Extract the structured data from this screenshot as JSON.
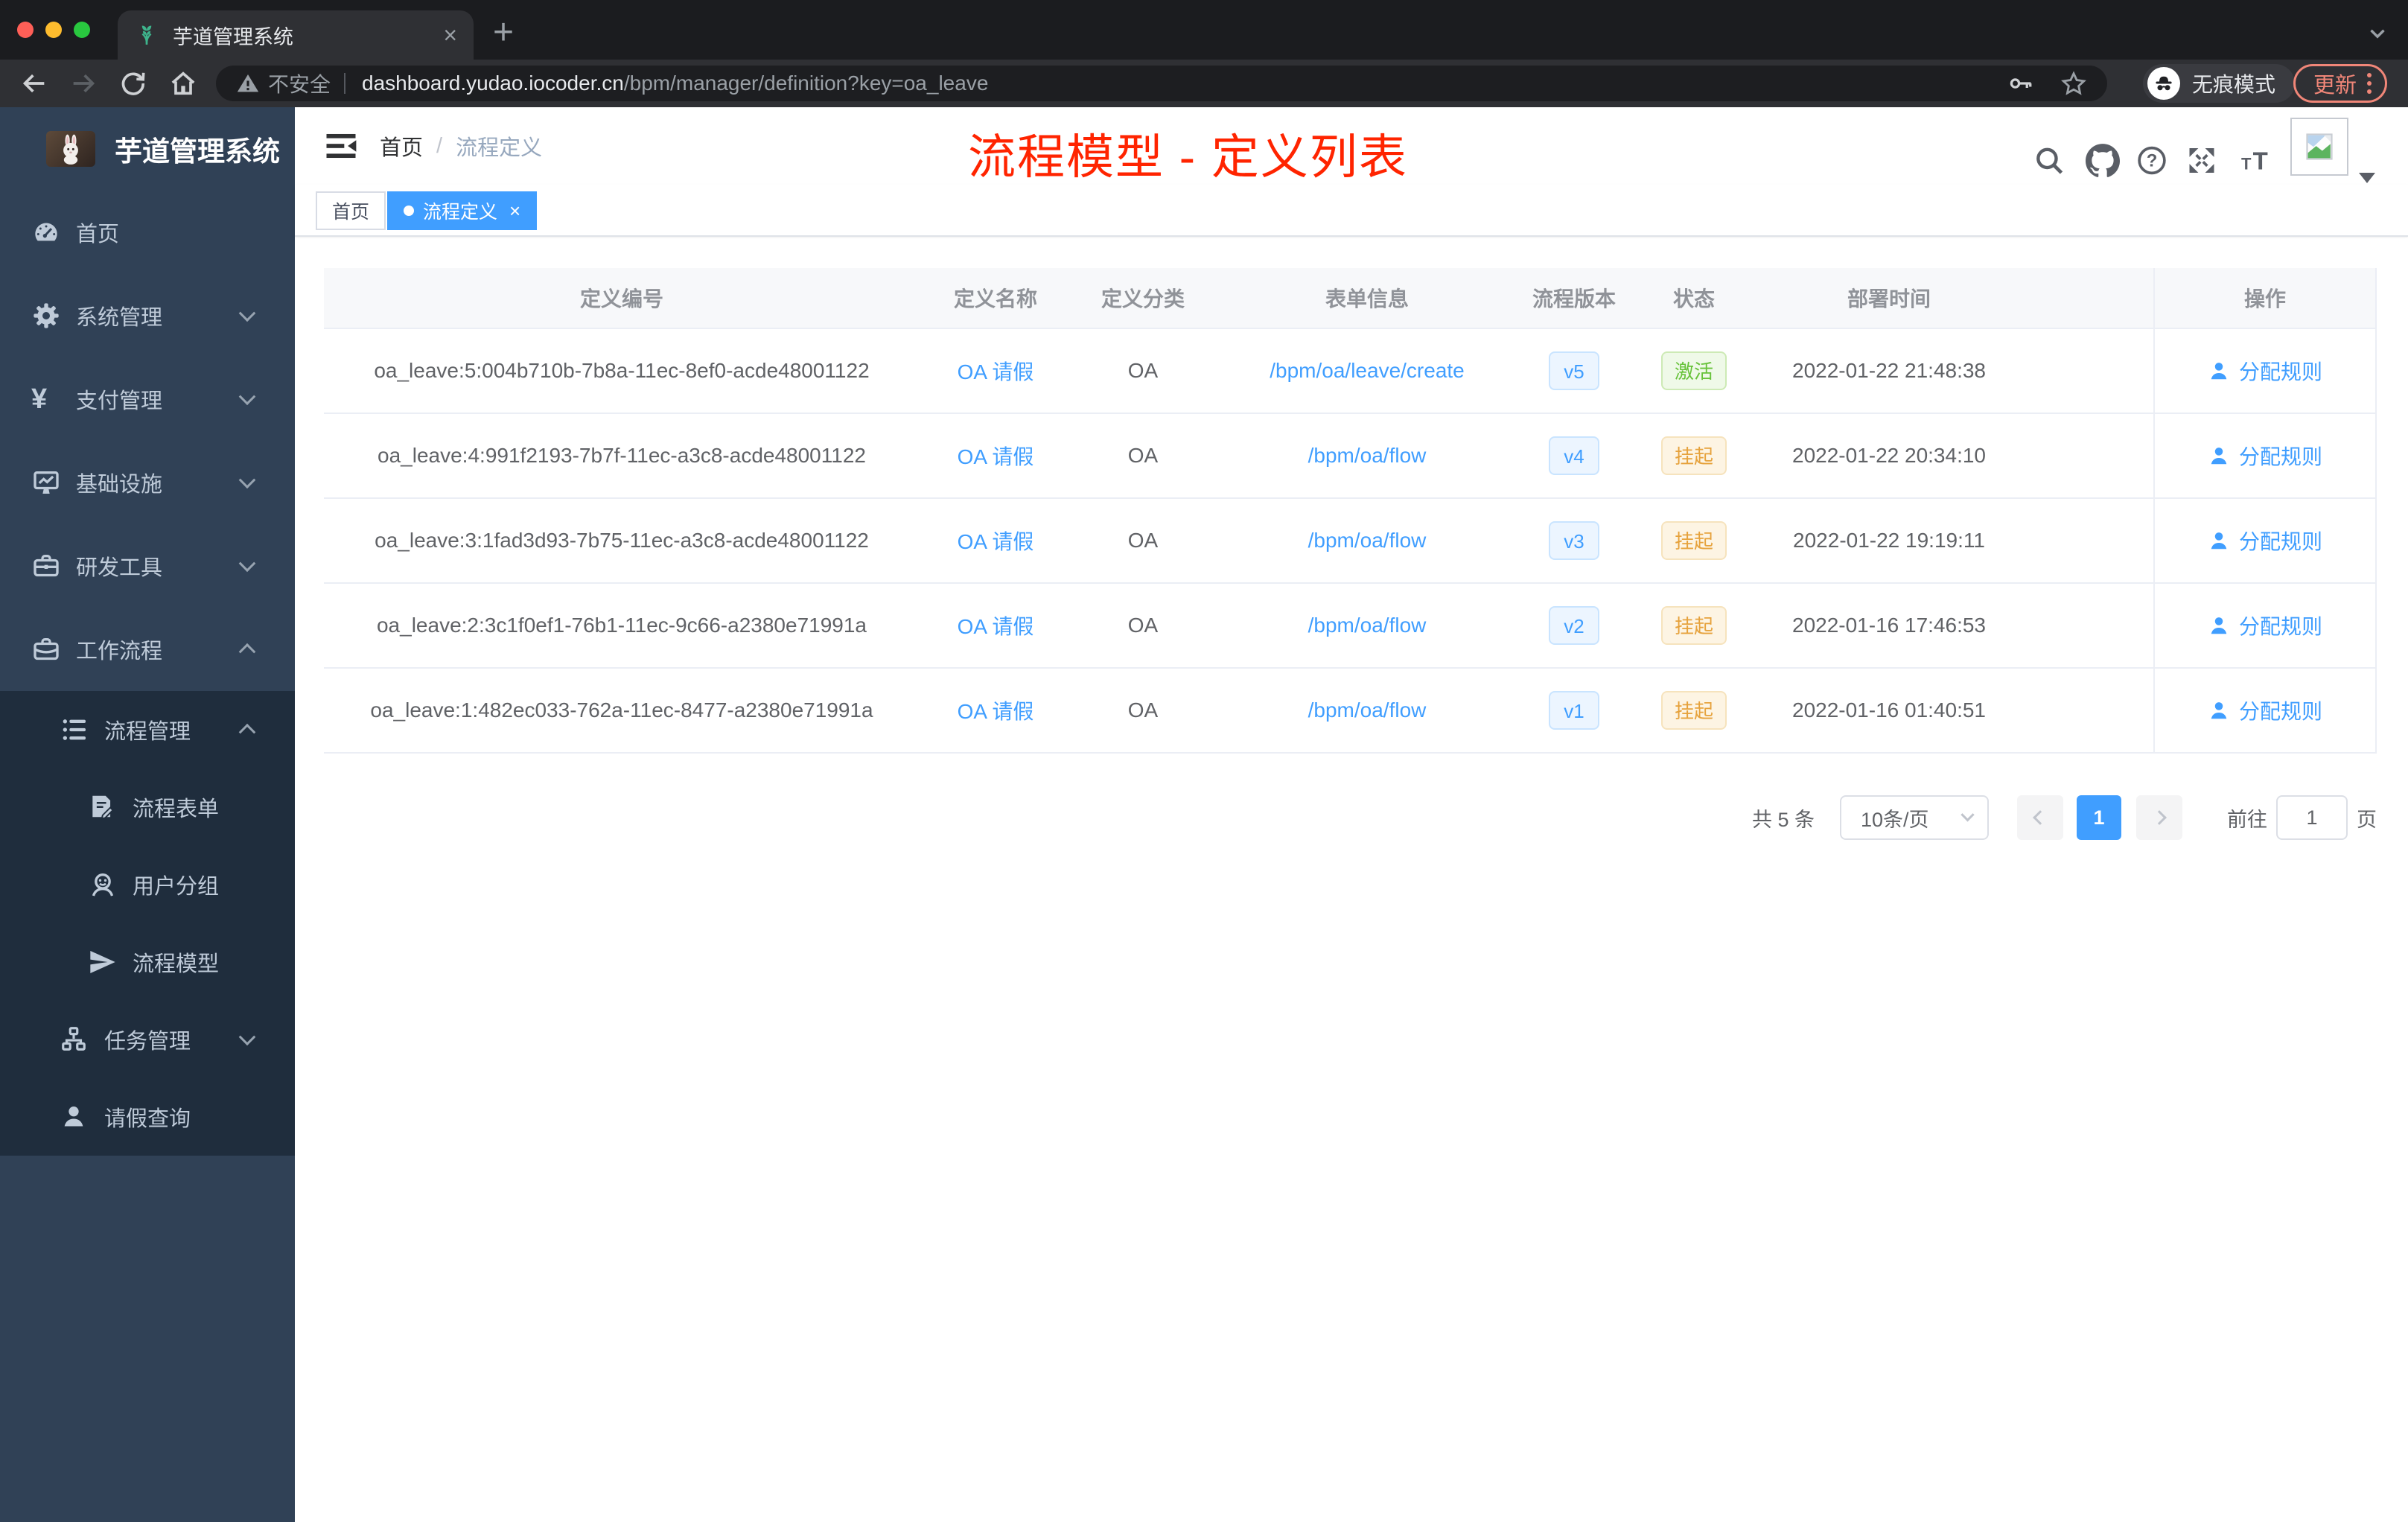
{
  "browser": {
    "tab": {
      "title": "芋道管理系统",
      "close_glyph": "×"
    },
    "new_tab_glyph": "+",
    "security_label": "不安全",
    "url_host": "dashboard.yudao.iocoder.cn",
    "url_path": "/bpm/manager/definition?key=oa_leave",
    "incognito_label": "无痕模式",
    "update_label": "更新"
  },
  "sidebar": {
    "logo_title": "芋道管理系统",
    "items": [
      {
        "label": "首页",
        "icon": "dashboard-icon",
        "level": 1,
        "chevron": null
      },
      {
        "label": "系统管理",
        "icon": "gear-icon",
        "level": 1,
        "chevron": "down"
      },
      {
        "label": "支付管理",
        "icon": "yen-icon",
        "level": 1,
        "chevron": "down"
      },
      {
        "label": "基础设施",
        "icon": "monitor-icon",
        "level": 1,
        "chevron": "down"
      },
      {
        "label": "研发工具",
        "icon": "toolbox-icon",
        "level": 1,
        "chevron": "down"
      },
      {
        "label": "工作流程",
        "icon": "briefcase-icon",
        "level": 1,
        "chevron": "up"
      },
      {
        "label": "流程管理",
        "icon": "tree-list-icon",
        "level": 2,
        "chevron": "up"
      },
      {
        "label": "流程表单",
        "icon": "form-edit-icon",
        "level": 3,
        "chevron": null
      },
      {
        "label": "用户分组",
        "icon": "user-group-icon",
        "level": 3,
        "chevron": null
      },
      {
        "label": "流程模型",
        "icon": "paper-plane-icon",
        "level": 3,
        "chevron": null
      },
      {
        "label": "任务管理",
        "icon": "tree-icon",
        "level": 2,
        "chevron": "down"
      },
      {
        "label": "请假查询",
        "icon": "person-icon",
        "level": 2,
        "chevron": null
      }
    ]
  },
  "header": {
    "breadcrumb_home": "首页",
    "breadcrumb_sep": "/",
    "breadcrumb_current": "流程定义",
    "annotation": "流程模型 - 定义列表",
    "right_icons": [
      "search-icon",
      "github-icon",
      "help-icon",
      "fullscreen-icon",
      "font-size-icon",
      "avatar",
      "caret-down-icon"
    ]
  },
  "tags": [
    {
      "label": "首页",
      "active": false
    },
    {
      "label": "流程定义",
      "active": true,
      "close_glyph": "×"
    }
  ],
  "table": {
    "columns": [
      "定义编号",
      "定义名称",
      "定义分类",
      "表单信息",
      "流程版本",
      "状态",
      "部署时间",
      "操作"
    ],
    "rows": [
      {
        "id": "oa_leave:5:004b710b-7b8a-11ec-8ef0-acde48001122",
        "name": "OA 请假",
        "category": "OA",
        "form": "/bpm/oa/leave/create",
        "version": "v5",
        "status": "激活",
        "status_type": "active",
        "deploy_time": "2022-01-22 21:48:38",
        "action": "分配规则"
      },
      {
        "id": "oa_leave:4:991f2193-7b7f-11ec-a3c8-acde48001122",
        "name": "OA 请假",
        "category": "OA",
        "form": "/bpm/oa/flow",
        "version": "v4",
        "status": "挂起",
        "status_type": "suspended",
        "deploy_time": "2022-01-22 20:34:10",
        "action": "分配规则"
      },
      {
        "id": "oa_leave:3:1fad3d93-7b75-11ec-a3c8-acde48001122",
        "name": "OA 请假",
        "category": "OA",
        "form": "/bpm/oa/flow",
        "version": "v3",
        "status": "挂起",
        "status_type": "suspended",
        "deploy_time": "2022-01-22 19:19:11",
        "action": "分配规则"
      },
      {
        "id": "oa_leave:2:3c1f0ef1-76b1-11ec-9c66-a2380e71991a",
        "name": "OA 请假",
        "category": "OA",
        "form": "/bpm/oa/flow",
        "version": "v2",
        "status": "挂起",
        "status_type": "suspended",
        "deploy_time": "2022-01-16 17:46:53",
        "action": "分配规则"
      },
      {
        "id": "oa_leave:1:482ec033-762a-11ec-8477-a2380e71991a",
        "name": "OA 请假",
        "category": "OA",
        "form": "/bpm/oa/flow",
        "version": "v1",
        "status": "挂起",
        "status_type": "suspended",
        "deploy_time": "2022-01-16 01:40:51",
        "action": "分配规则"
      }
    ]
  },
  "pagination": {
    "total": "共 5 条",
    "page_size": "10条/页",
    "current_page": "1",
    "goto_label": "前往",
    "goto_value": "1",
    "goto_suffix": "页"
  },
  "colors": {
    "accent_blue": "#409eff",
    "status_active_green": "#67c23a",
    "status_suspended_orange": "#e6a23c",
    "annotation_red": "#ff2400",
    "sidebar_bg": "#304156",
    "sidebar_submenu_bg": "#1f2d3d",
    "update_button_salmon": "#f08678"
  }
}
